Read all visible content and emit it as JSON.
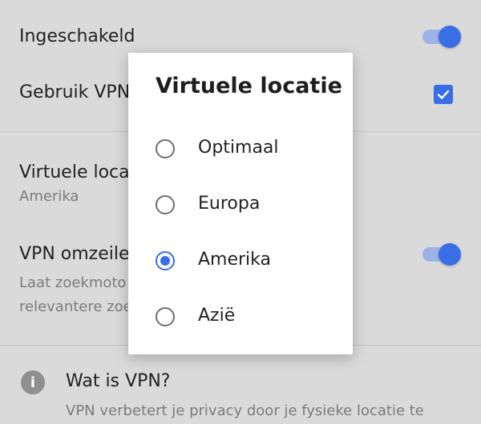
{
  "settings": {
    "enabled_label": "Ingeschakeld",
    "use_vpn_label": "Gebruik VPN",
    "location_label": "Virtuele locat",
    "location_value": "Amerika",
    "bypass_label": "VPN omzeilen",
    "bypass_desc_line1": "Laat zoekmoto",
    "bypass_desc_line2": "relevantere zoe",
    "info_title": "Wat is VPN?",
    "info_desc": "VPN verbetert je privacy door je fysieke locatie te"
  },
  "dialog": {
    "title": "Virtuele locatie",
    "options": [
      {
        "label": "Optimaal",
        "selected": false
      },
      {
        "label": "Europa",
        "selected": false
      },
      {
        "label": "Amerika",
        "selected": true
      },
      {
        "label": "Azië",
        "selected": false
      }
    ]
  },
  "icons": {
    "info": "info-icon",
    "check": "check-icon"
  },
  "colors": {
    "accent": "#3a6ee4",
    "switch_track": "#9db2e6",
    "background_dimmed": "#dadada"
  }
}
